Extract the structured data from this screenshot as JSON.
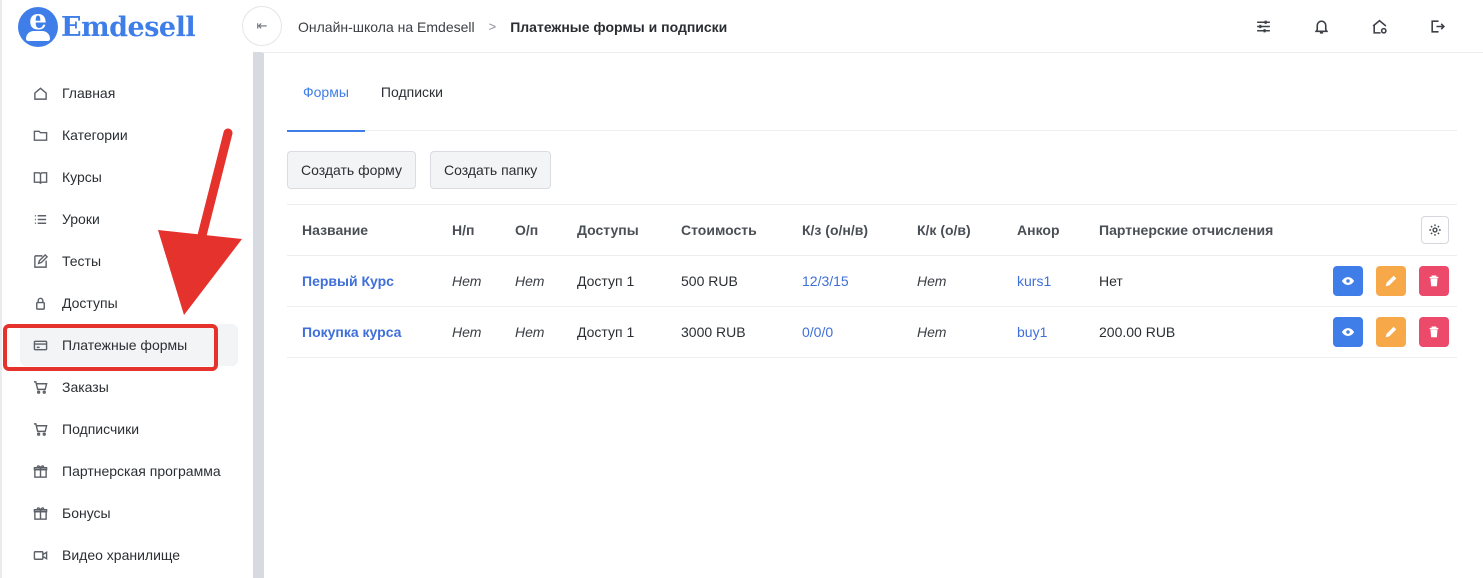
{
  "brand": {
    "name": "Emdesell",
    "logo_letter": "e",
    "color": "#3f7ee8"
  },
  "sidebar": {
    "items": [
      {
        "label": "Главная",
        "icon": "home-icon"
      },
      {
        "label": "Категории",
        "icon": "folder-icon"
      },
      {
        "label": "Курсы",
        "icon": "book-icon"
      },
      {
        "label": "Уроки",
        "icon": "list-icon"
      },
      {
        "label": "Тесты",
        "icon": "edit-icon"
      },
      {
        "label": "Доступы",
        "icon": "lock-icon"
      },
      {
        "label": "Платежные формы",
        "icon": "credit-card-icon",
        "active": true
      },
      {
        "label": "Заказы",
        "icon": "cart-icon"
      },
      {
        "label": "Подписчики",
        "icon": "cart-icon"
      },
      {
        "label": "Партнерская программа",
        "icon": "gift-icon"
      },
      {
        "label": "Бонусы",
        "icon": "gift-icon"
      },
      {
        "label": "Видео хранилище",
        "icon": "video-icon"
      }
    ]
  },
  "header": {
    "collapse_icon": "collapse-sidebar-icon",
    "breadcrumb": [
      "Онлайн-школа на Emdesell",
      "Платежные формы и подписки"
    ],
    "icons": [
      "sliders-icon",
      "bell-icon",
      "home-settings-icon",
      "logout-icon"
    ]
  },
  "main": {
    "tabs": [
      {
        "label": "Формы",
        "active": true
      },
      {
        "label": "Подписки",
        "active": false
      }
    ],
    "buttons": {
      "create_form": "Создать форму",
      "create_folder": "Создать папку"
    },
    "table": {
      "columns": [
        "Название",
        "Н/п",
        "О/п",
        "Доступы",
        "Стоимость",
        "К/з (о/н/в)",
        "К/к (о/в)",
        "Анкор",
        "Партнерские отчисления"
      ],
      "rows": [
        {
          "name": "Первый Курс",
          "np": "Нет",
          "op": "Нет",
          "access": "Доступ 1",
          "price": "500 RUB",
          "kz": "12/3/15",
          "kk": "Нет",
          "anchor": "kurs1",
          "partner": "Нет"
        },
        {
          "name": "Покупка курса",
          "np": "Нет",
          "op": "Нет",
          "access": "Доступ 1",
          "price": "3000 RUB",
          "kz": "0/0/0",
          "kk": "Нет",
          "anchor": "buy1",
          "partner": "200.00 RUB"
        }
      ]
    }
  },
  "colors": {
    "accent": "#3f7ee8",
    "view": "#3f7ee8",
    "edit": "#f7a94a",
    "delete": "#ec4a6b",
    "highlight": "#e5322c"
  }
}
